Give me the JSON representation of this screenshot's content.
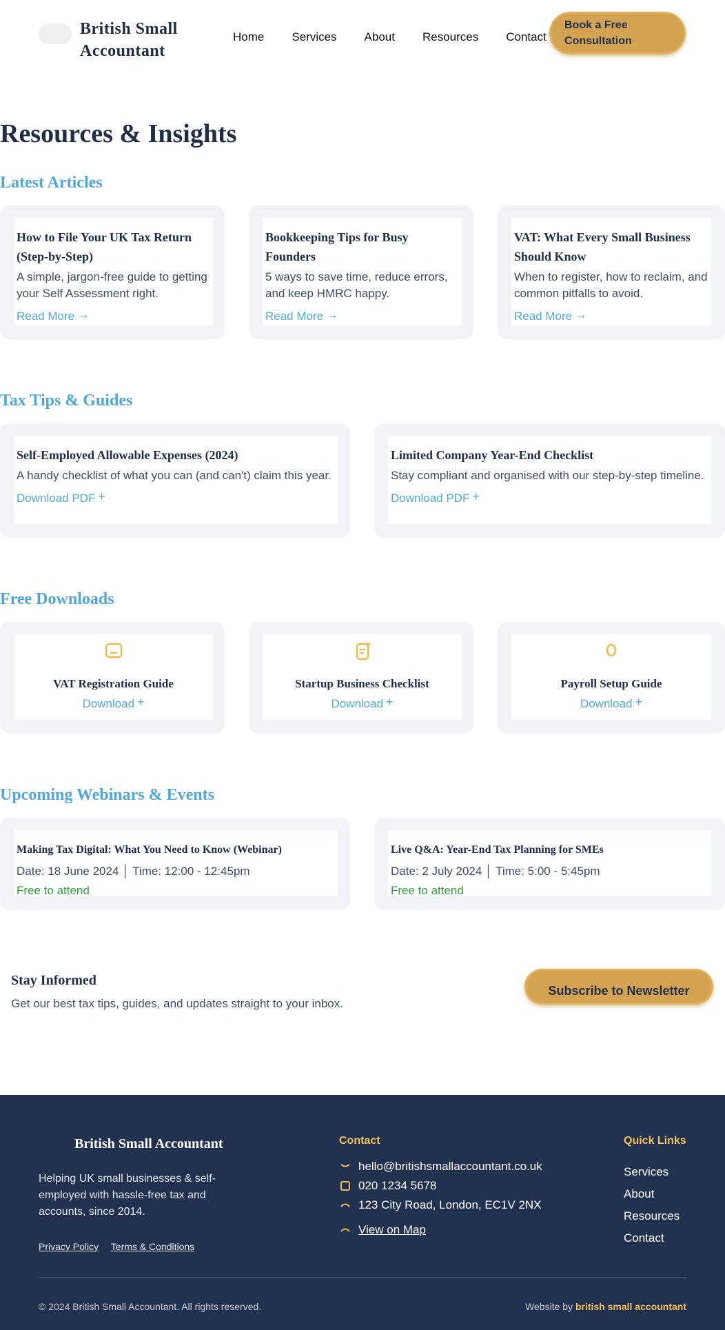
{
  "header": {
    "brand": "British Small Accountant",
    "nav": [
      "Home",
      "Services",
      "About",
      "Resources",
      "Contact"
    ],
    "cta": "Book a Free Consultation"
  },
  "page_title": "Resources & Insights",
  "articles": {
    "title": "Latest Articles",
    "items": [
      {
        "title": "How to File Your UK Tax Return (Step-by-Step)",
        "desc": "A simple, jargon-free guide to getting your Self Assessment right.",
        "link": "Read More"
      },
      {
        "title": "Bookkeeping Tips for Busy Founders",
        "desc": "5 ways to save time, reduce errors, and keep HMRC happy.",
        "link": "Read More"
      },
      {
        "title": "VAT: What Every Small Business Should Know",
        "desc": "When to register, how to reclaim, and common pitfalls to avoid.",
        "link": "Read More"
      }
    ]
  },
  "guides": {
    "title": "Tax Tips & Guides",
    "items": [
      {
        "title": "Self-Employed Allowable Expenses (2024)",
        "desc": "A handy checklist of what you can (and can't) claim this year.",
        "link": "Download PDF"
      },
      {
        "title": "Limited Company Year-End Checklist",
        "desc": "Stay compliant and organised with our step-by-step timeline.",
        "link": "Download PDF"
      }
    ]
  },
  "downloads": {
    "title": "Free Downloads",
    "items": [
      {
        "title": "VAT Registration Guide",
        "link": "Download",
        "icon": "document-icon"
      },
      {
        "title": "Startup Business Checklist",
        "link": "Download",
        "icon": "checklist-icon"
      },
      {
        "title": "Payroll Setup Guide",
        "link": "Download",
        "icon": "payroll-icon"
      }
    ]
  },
  "events": {
    "title": "Upcoming Webinars & Events",
    "items": [
      {
        "title": "Making Tax Digital: What You Need to Know (Webinar)",
        "when": "Date: 18 June 2024 │ Time: 12:00 - 12:45pm",
        "note": "Free to attend"
      },
      {
        "title": "Live Q&A: Year-End Tax Planning for SMEs",
        "when": "Date: 2 July 2024 │ Time: 5:00 - 5:45pm",
        "note": "Free to attend"
      }
    ]
  },
  "newsletter": {
    "title": "Stay Informed",
    "text": "Get our best tax tips, guides, and updates straight to your inbox.",
    "button": "Subscribe to Newsletter"
  },
  "footer": {
    "brand": "British Small Accountant",
    "about": "Helping UK small businesses & self-employed with hassle-free tax and accounts, since 2014.",
    "privacy": "Privacy Policy",
    "terms": "Terms & Conditions",
    "contact_heading": "Contact",
    "email": "hello@britishsmallaccountant.co.uk",
    "phone": "020 1234 5678",
    "address": "123 City Road, London, EC1V 2NX",
    "map": "View on Map",
    "links_heading": "Quick Links",
    "links": [
      "Services",
      "About",
      "Resources",
      "Contact"
    ],
    "copyright": "© 2024 British Small Accountant. All rights reserved.",
    "credit_prefix": "Website by",
    "credit_name": "british small accountant"
  },
  "colors": {
    "navy": "#1f2d46",
    "accent_blue": "#4fa7dd",
    "gold": "#d4a352",
    "green": "#2e9e3a",
    "footer_bg": "#233151"
  }
}
